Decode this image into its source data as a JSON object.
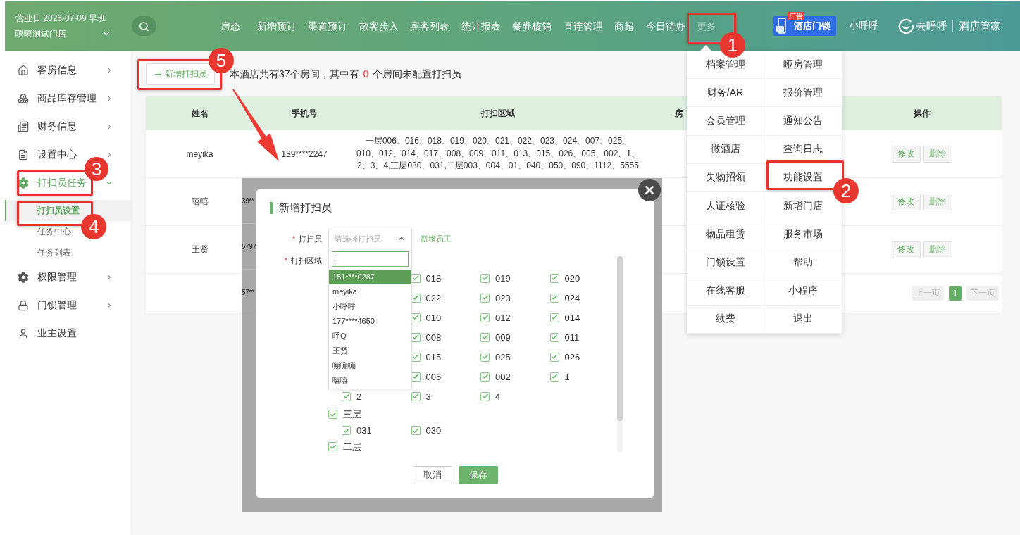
{
  "header": {
    "business_day": "营业日 2026-07-09 早班",
    "store": "嘻嘻测试门店",
    "nav": [
      {
        "label": "房态",
        "open": false
      },
      {
        "label": "新增预订",
        "open": false
      },
      {
        "label": "渠道预订",
        "open": false
      },
      {
        "label": "散客步入",
        "open": false
      },
      {
        "label": "宾客列表",
        "open": false
      },
      {
        "label": "统计报表",
        "open": false
      },
      {
        "label": "餐券核销",
        "open": false
      },
      {
        "label": "直连管理",
        "open": false
      },
      {
        "label": "商超",
        "open": false
      },
      {
        "label": "今日待办",
        "open": false
      },
      {
        "label": "更多",
        "open": true
      }
    ],
    "ad": {
      "label": "酒店门锁",
      "tag": "广告"
    },
    "user": "小呼呼",
    "brand": {
      "name": "去呼呼",
      "product": "酒店管家"
    }
  },
  "more_menu": {
    "items": [
      {
        "label": "档案管理"
      },
      {
        "label": "哑房管理"
      },
      {
        "label": "财务/AR"
      },
      {
        "label": "报价管理"
      },
      {
        "label": "会员管理"
      },
      {
        "label": "通知公告"
      },
      {
        "label": "微酒店"
      },
      {
        "label": "查询日志"
      },
      {
        "label": "失物招领"
      },
      {
        "label": "功能设置"
      },
      {
        "label": "人证核验"
      },
      {
        "label": "新增门店"
      },
      {
        "label": "物品租赁"
      },
      {
        "label": "服务市场"
      },
      {
        "label": "门锁设置"
      },
      {
        "label": "帮助"
      },
      {
        "label": "在线客服"
      },
      {
        "label": "小程序"
      },
      {
        "label": "续费"
      },
      {
        "label": "退出"
      }
    ]
  },
  "sidebar": {
    "items": [
      {
        "label": "客房信息",
        "selected": false,
        "expanded": false
      },
      {
        "label": "商品库存管理",
        "selected": false,
        "expanded": false
      },
      {
        "label": "财务信息",
        "selected": false,
        "expanded": false
      },
      {
        "label": "设置中心",
        "selected": false,
        "expanded": false
      },
      {
        "label": "打扫员任务",
        "selected": true,
        "expanded": true,
        "children": [
          {
            "label": "打扫员设置",
            "selected": true
          },
          {
            "label": "任务中心",
            "selected": false
          },
          {
            "label": "任务列表",
            "selected": false
          }
        ]
      },
      {
        "label": "权限管理",
        "selected": false,
        "expanded": false
      },
      {
        "label": "门锁管理",
        "selected": false,
        "expanded": false
      },
      {
        "label": "业主设置",
        "selected": false
      }
    ]
  },
  "toolbar": {
    "add_button": "新增打扫员",
    "summary_before": "本酒店共有37个房间，其中有",
    "unassigned_count": "0",
    "summary_after": "个房间未配置打扫员"
  },
  "table": {
    "columns": [
      {
        "label": "姓名"
      },
      {
        "label": "手机号"
      },
      {
        "label": "打扫区域"
      },
      {
        "label": "房"
      },
      {
        "label": "操作"
      }
    ],
    "rows": [
      {
        "name": "meyika",
        "phone": "139****2247",
        "area": "一层006、016、018、019、020、021、022、023、024、007、025、010、012、014、017、008、009、011、013、015、026、005、002、1、2、3、4,三层030、031,二层003、004、01、040、050、090、1112、5555",
        "actions": [
          {
            "label": "修改",
            "kind": "edit"
          },
          {
            "label": "删除",
            "kind": "delete"
          }
        ]
      },
      {
        "name": "嘻嘻",
        "actions": [
          {
            "label": "修改",
            "kind": "edit"
          },
          {
            "label": "删除",
            "kind": "delete"
          }
        ]
      },
      {
        "name": "王贤",
        "actions": [
          {
            "label": "修改",
            "kind": "edit"
          },
          {
            "label": "删除",
            "kind": "delete"
          }
        ]
      }
    ],
    "pagination": {
      "prev": {
        "label": "上一页",
        "disabled": true
      },
      "pages": [
        {
          "label": "1",
          "selected": true
        }
      ],
      "next": {
        "label": "下一页",
        "disabled": true
      }
    }
  },
  "dialog": {
    "background_cells": [
      "39**",
      "5797",
      "57**"
    ],
    "title": "新增打扫员",
    "cleaner": {
      "required_mark": "*",
      "label": "打扫员",
      "placeholder": "请选择打扫员",
      "open": true,
      "options": [
        {
          "label": "181****0287",
          "selected": true
        },
        {
          "label": "meyika",
          "selected": false
        },
        {
          "label": "小呼呼",
          "selected": false
        },
        {
          "label": "177****4650",
          "selected": false
        },
        {
          "label": "呼Q",
          "selected": false
        },
        {
          "label": "王贤",
          "selected": false
        },
        {
          "label": "嘣嘣嘣",
          "selected": false
        },
        {
          "label": "嘻嘻",
          "selected": false
        }
      ]
    },
    "add_staff_link": "新增员工",
    "area": {
      "required_mark": "*",
      "label": "打扫区域",
      "groups": [
        {
          "kind": "rooms",
          "rooms": [
            {
              "label": "018",
              "checked": true
            },
            {
              "label": "019",
              "checked": true
            },
            {
              "label": "020",
              "checked": true
            },
            {
              "label": "022",
              "checked": true
            },
            {
              "label": "023",
              "checked": true
            },
            {
              "label": "024",
              "checked": true
            },
            {
              "label": "010",
              "checked": true
            },
            {
              "label": "012",
              "checked": true
            },
            {
              "label": "014",
              "checked": true
            },
            {
              "label": "008",
              "checked": true
            },
            {
              "label": "009",
              "checked": true
            },
            {
              "label": "011",
              "checked": true
            },
            {
              "label": "015",
              "checked": true
            },
            {
              "label": "025",
              "checked": true
            },
            {
              "label": "026",
              "checked": true
            },
            {
              "label": "006",
              "checked": true
            },
            {
              "label": "002",
              "checked": true
            },
            {
              "label": "1",
              "checked": true
            },
            {
              "label": "2",
              "checked": true
            },
            {
              "label": "3",
              "checked": true
            },
            {
              "label": "4",
              "checked": true
            }
          ]
        },
        {
          "kind": "floor",
          "label": "三层",
          "checked": true,
          "rooms": [
            {
              "label": "031",
              "checked": true
            },
            {
              "label": "030",
              "checked": true
            }
          ]
        },
        {
          "kind": "floor",
          "label": "二层",
          "checked": true
        }
      ]
    },
    "buttons": [
      {
        "label": "取消",
        "kind": "cancel"
      },
      {
        "label": "保存",
        "kind": "save"
      }
    ]
  },
  "annotations": [
    {
      "number": "1"
    },
    {
      "number": "2"
    },
    {
      "number": "3"
    },
    {
      "number": "4"
    },
    {
      "number": "5"
    }
  ]
}
